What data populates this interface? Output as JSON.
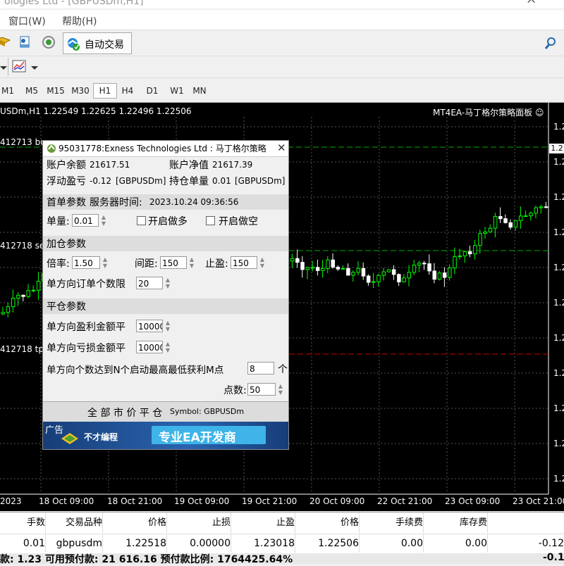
{
  "window": {
    "title": "ologies Ltd - [GBPUSDm,H1]"
  },
  "menu": {
    "items": [
      "窗口(W)",
      "帮助(H)"
    ]
  },
  "toolbar": {
    "auto_trading_label": "自动交易"
  },
  "timeframes": [
    "M1",
    "M5",
    "M15",
    "M30",
    "H1",
    "H4",
    "D1",
    "W1",
    "MN"
  ],
  "active_timeframe": "H1",
  "chart": {
    "header": "USDm,H1  1.22549 1.22625 1.22496 1.22506",
    "ea_label": "MT4EA-马丁格尔策略面板 ☺",
    "order_labels": [
      "412713 bu",
      "412718 se",
      "412718 tp"
    ],
    "price_axis": [
      "1.2",
      "1.2",
      "1.2",
      "1.2",
      "1.2",
      "1.2",
      "1.2",
      "1.2",
      "1.2",
      "1.2",
      "1.2",
      "1.2"
    ],
    "current_price_tag": "1.2",
    "time_axis": [
      "2023",
      "18 Oct 09:00",
      "18 Oct 21:00",
      "19 Oct 09:00",
      "19 Oct 21:00",
      "20 Oct 09:00",
      "22 Oct 21:00",
      "23 Oct 09:00",
      "23 Oct 21:00"
    ],
    "colors": {
      "background": "#000000",
      "bull": "#00ff00",
      "bear": "#ffffff",
      "grid": "#555555"
    }
  },
  "panel": {
    "title": "95031778:Exness Technologies Ltd : 马丁格尔策略",
    "balance_label": "账户余额",
    "balance_value": "21617.51",
    "equity_label": "账户净值",
    "equity_value": "21617.39",
    "floating_label": "浮动盈亏",
    "floating_value": "-0.12",
    "floating_symbol": "[GBPUSDm]",
    "positions_label": "持仓单量",
    "positions_value": "0.01",
    "positions_symbol": "[GBPUSDm]",
    "first_order_section": "首单参数",
    "server_time_label": "服务器时间:",
    "server_time_value": "2023.10.24 09:36:56",
    "lot_label": "单量:",
    "lot_value": "0.01",
    "open_long_label": "开启做多",
    "open_short_label": "开启做空",
    "add_section": "加仓参数",
    "multiplier_label": "倍率:",
    "multiplier_value": "1.50",
    "interval_label": "间距:",
    "interval_value": "150",
    "tp_label": "止盈:",
    "tp_value": "150",
    "max_orders_label": "单方向订单个数限",
    "max_orders_value": "20",
    "close_section": "平仓参数",
    "profit_close_label": "单方向盈利金额平",
    "profit_close_value": "10000",
    "loss_close_label": "单方向亏损金额平",
    "loss_close_value": "10000",
    "count_trigger_label": "单方向个数达到N个启动最高最低获利M点",
    "count_trigger_value": "8",
    "count_trigger_unit": "个",
    "points_label": "点数:",
    "points_value": "50",
    "close_all_label": "全 部 市 价 平 仓",
    "close_all_symbol": "Symbol:  GBPUSDm",
    "ad_label": "广告",
    "ad_brand": "不才编程",
    "ad_slogan": "专业EA开发商"
  },
  "terminal": {
    "headers": [
      "手数",
      "交易品种",
      "价格",
      "止损",
      "止盈",
      "价格",
      "手续费",
      "库存费",
      ""
    ],
    "row": [
      "0.01",
      "gbpusdm",
      "1.22518",
      "0.00000",
      "1.23018",
      "1.22506",
      "0.00",
      "0.00",
      "-0.12"
    ],
    "summary": "款: 1.23  可用预付款: 21 616.16  预付款比例: 1764425.64%",
    "summary_right": "-0.1"
  }
}
